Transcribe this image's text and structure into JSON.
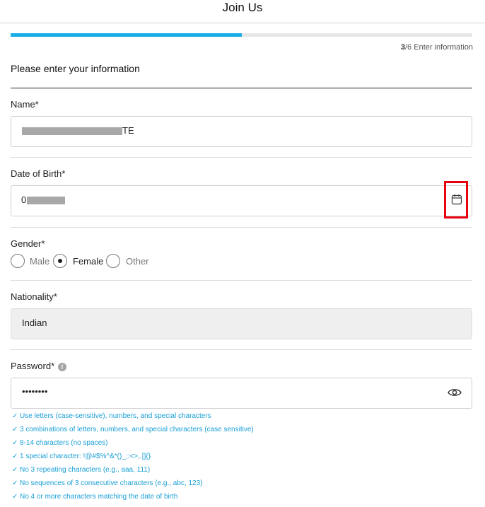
{
  "header": {
    "title": "Join Us"
  },
  "progress": {
    "current": "3",
    "total": "/6",
    "label": "Enter information",
    "fraction": 0.5
  },
  "section_title": "Please enter your information",
  "name": {
    "label": "Name*",
    "value_suffix": "TE"
  },
  "dob": {
    "label": "Date of Birth*",
    "value_prefix": "0"
  },
  "gender": {
    "label": "Gender*",
    "options": [
      "Male",
      "Female",
      "Other"
    ],
    "selected": "Female"
  },
  "nationality": {
    "label": "Nationality*",
    "value": "Indian"
  },
  "password": {
    "label": "Password*",
    "value": "••••••••",
    "rules": [
      "Use letters (case-sensitive), numbers, and special characters",
      "3 combinations of letters, numbers, and special characters (case sensitive)",
      "8-14 characters (no spaces)",
      "1 special character: !@#$%^&*()_;:<>,.[]{}",
      "No 3 repeating characters (e.g., aaa, 111)",
      "No sequences of 3 consecutive characters (e.g., abc, 123)",
      "No 4 or more characters matching the date of birth"
    ]
  },
  "icons": {
    "calendar": "calendar-icon",
    "eye": "eye-icon",
    "info": "info-icon",
    "check": "check-icon"
  },
  "colors": {
    "accent": "#1aaee6",
    "highlight": "#e8000f",
    "rule_text": "#1a9fd6"
  }
}
